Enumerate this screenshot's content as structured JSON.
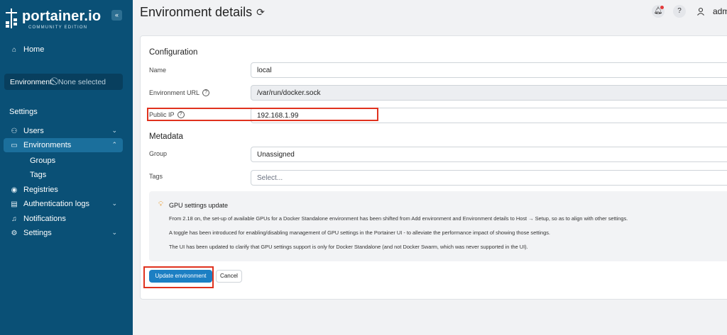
{
  "sidebar": {
    "logo_text": "portainer.io",
    "logo_sub": "COMMUNITY EDITION",
    "collapse_icon": "«",
    "home": "Home",
    "environment_label": "Environment:",
    "environment_value": "None selected",
    "settings_header": "Settings",
    "items": {
      "users": "Users",
      "environments": "Environments",
      "groups": "Groups",
      "tags": "Tags",
      "registries": "Registries",
      "auth_logs": "Authentication logs",
      "notifications": "Notifications",
      "settings": "Settings"
    },
    "colors": {
      "background": "#0a5076",
      "active": "#1b6f9c"
    }
  },
  "header": {
    "title": "Environment details",
    "user": "adm"
  },
  "form": {
    "configuration_title": "Configuration",
    "name_label": "Name",
    "name_value": "local",
    "url_label": "Environment URL",
    "url_value": "/var/run/docker.sock",
    "public_ip_label": "Public IP",
    "public_ip_value": "192.168.1.99",
    "metadata_title": "Metadata",
    "group_label": "Group",
    "group_value": "Unassigned",
    "tags_label": "Tags",
    "tags_placeholder": "Select..."
  },
  "info": {
    "title": "GPU settings update",
    "line1": "From 2.18 on, the set-up of available GPUs for a Docker Standalone environment has been shifted from Add environment and Environment details to Host → Setup, so as to align with other settings.",
    "line2": "A toggle has been introduced for enabling/disabling management of GPU settings in the Portainer UI - to alleviate the performance impact of showing those settings.",
    "line3": "The UI has been updated to clarify that GPU settings support is only for Docker Standalone (and not Docker Swarm, which was never supported in the UI)."
  },
  "actions": {
    "update": "Update environment",
    "cancel": "Cancel"
  },
  "colors": {
    "accent": "#1c7fc3",
    "highlight": "#e0321e"
  }
}
